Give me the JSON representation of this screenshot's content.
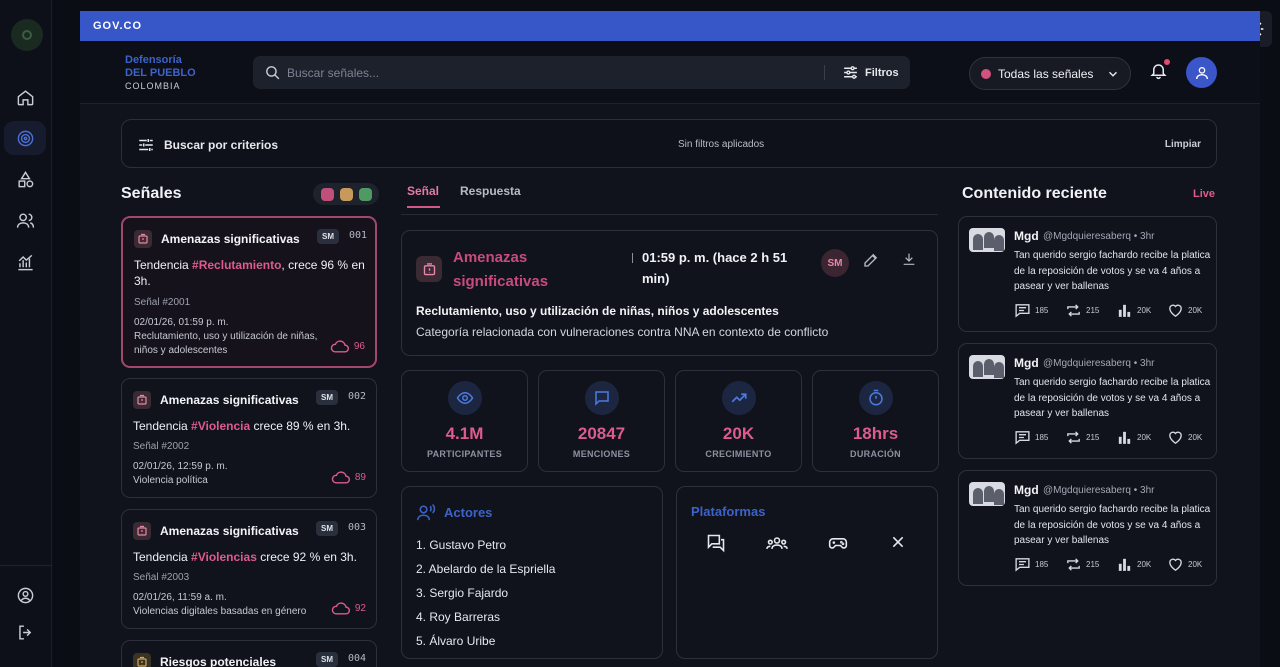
{
  "gov": {
    "label": "GOV.CO"
  },
  "brand": {
    "line1": "Defensoría",
    "line2": "DEL PUEBLO",
    "line3": "COLOMBIA"
  },
  "search": {
    "placeholder": "Buscar señales...",
    "filters_label": "Filtros"
  },
  "all_signals": {
    "label": "Todas las señales",
    "dot_color": "#d0527e"
  },
  "criteria": {
    "label": "Buscar por criterios",
    "status": "Sin filtros aplicados",
    "clear": "Limpiar"
  },
  "signals": {
    "title": "Señales",
    "filter_colors": [
      "#c0507a",
      "#c79a5c",
      "#4f9a63"
    ],
    "cards": [
      {
        "title": "Amenazas significativas",
        "badge": "SM",
        "number": "001",
        "trend_prefix": "Tendencia ",
        "hashtag": "#Reclutamiento",
        "trend_suffix": ", crece 96 % en 3h.",
        "signal_id": "Señal #2001",
        "datetime": "02/01/26, 01:59 p. m.",
        "category": "Reclutamiento, uso y utilización de niñas, niños y adolescentes",
        "count": "96"
      },
      {
        "title": "Amenazas significativas",
        "badge": "SM",
        "number": "002",
        "trend_prefix": "Tendencia ",
        "hashtag": "#Violencia",
        "trend_suffix": " crece 89 % en 3h.",
        "signal_id": "Señal #2002",
        "datetime": "02/01/26, 12:59 p. m.",
        "category": "Violencia política",
        "count": "89"
      },
      {
        "title": "Amenazas significativas",
        "badge": "SM",
        "number": "003",
        "trend_prefix": "Tendencia ",
        "hashtag": "#Violencias",
        "trend_suffix": " crece 92 % en 3h.",
        "signal_id": "Señal #2003",
        "datetime": "02/01/26, 11:59 a. m.",
        "category": "Violencias digitales basadas en género",
        "count": "92"
      },
      {
        "title": "Riesgos potenciales",
        "badge": "SM",
        "number": "004"
      }
    ]
  },
  "tabs": [
    {
      "label": "Señal"
    },
    {
      "label": "Respuesta"
    }
  ],
  "detail": {
    "title": "Amenazas significativas",
    "time": "01:59 p. m. (hace 2 h 51 min)",
    "badge": "SM",
    "category": "Reclutamiento, uso y utilización de niñas, niños y adolescentes",
    "description": "Categoría relacionada con vulneraciones contra NNA en contexto de conflicto"
  },
  "stats": [
    {
      "value": "4.1M",
      "label": "PARTICIPANTES",
      "icon": "eye-icon"
    },
    {
      "value": "20847",
      "label": "MENCIONES",
      "icon": "message-icon"
    },
    {
      "value": "20K",
      "label": "CRECIMIENTO",
      "icon": "trending-up-icon"
    },
    {
      "value": "18hrs",
      "label": "DURACIÓN",
      "icon": "stopwatch-icon"
    }
  ],
  "actors": {
    "title": "Actores",
    "items": [
      "1. Gustavo Petro",
      "2. Abelardo de la Espriella",
      "3. Sergio Fajardo",
      "4. Roy Barreras",
      "5. Álvaro Uribe"
    ]
  },
  "platforms": {
    "title": "Plataformas",
    "icons": [
      "forum-icon",
      "groups-icon",
      "gamepad-icon",
      "x-icon"
    ]
  },
  "recent": {
    "title": "Contenido reciente",
    "live": "Live",
    "posts": [
      {
        "name": "Mgd",
        "handle": "@Mgdquieresaberq • 3hr",
        "text": "Tan querido sergio fachardo recibe la platica de la reposición de votos y se va 4 años a pasear y ver ballenas",
        "replies": "185",
        "reposts": "215",
        "views": "20K",
        "likes": "20K"
      },
      {
        "name": "Mgd",
        "handle": "@Mgdquieresaberq • 3hr",
        "text": "Tan querido sergio fachardo recibe la platica de la reposición de votos y se va 4 años a pasear y ver ballenas",
        "replies": "185",
        "reposts": "215",
        "views": "20K",
        "likes": "20K"
      },
      {
        "name": "Mgd",
        "handle": "@Mgdquieresaberq • 3hr",
        "text": "Tan querido sergio fachardo recibe la platica de la reposición de votos y se va 4 años a pasear y ver ballenas",
        "replies": "185",
        "reposts": "215",
        "views": "20K",
        "likes": "20K"
      }
    ]
  },
  "colors": {
    "accent_pink": "#dd5b8d",
    "brand_blue": "#3756c8",
    "background": "#0b0d14"
  }
}
